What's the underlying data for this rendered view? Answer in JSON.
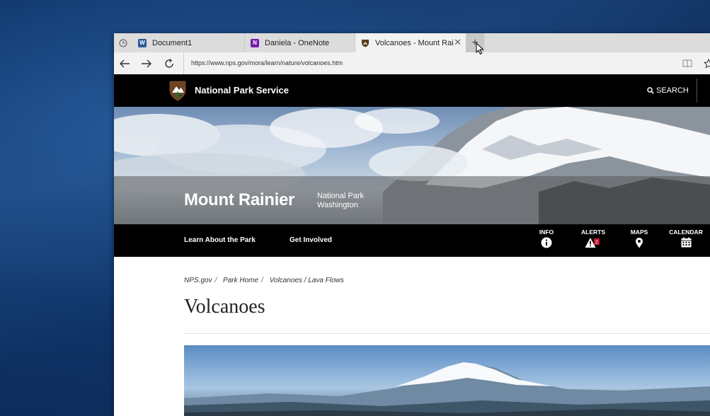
{
  "tabs": [
    {
      "label": "Document1",
      "icon": "word-icon"
    },
    {
      "label": "Daniela - OneNote",
      "icon": "onenote-icon"
    },
    {
      "label": "Volcanoes - Mount Rai",
      "icon": "nps-favicon-icon",
      "active": true
    }
  ],
  "address": {
    "url": "https://www.nps.gov/mora/learn/nature/volcanoes.htm"
  },
  "nps_header": {
    "title": "National Park Service",
    "search_label": "SEARCH"
  },
  "park": {
    "name": "Mount Rainier",
    "designation": "National Park",
    "state": "Washington"
  },
  "park_nav": {
    "links": [
      "Learn About the Park",
      "Get Involved"
    ],
    "icons": [
      {
        "label": "INFO",
        "icon": "info-icon"
      },
      {
        "label": "ALERTS",
        "icon": "alert-icon",
        "badge": "2"
      },
      {
        "label": "MAPS",
        "icon": "map-pin-icon"
      },
      {
        "label": "CALENDAR",
        "icon": "calendar-icon"
      }
    ]
  },
  "breadcrumbs": [
    "NPS.gov",
    "Park Home",
    "Volcanoes / Lava Flows"
  ],
  "page": {
    "title": "Volcanoes"
  },
  "colors": {
    "nps_black": "#000000",
    "tab_bar": "#dcdcdc",
    "active_tab": "#f2f2f2",
    "alert_badge": "#c8102e",
    "word_blue": "#2b579a",
    "onenote_purple": "#7719aa"
  }
}
